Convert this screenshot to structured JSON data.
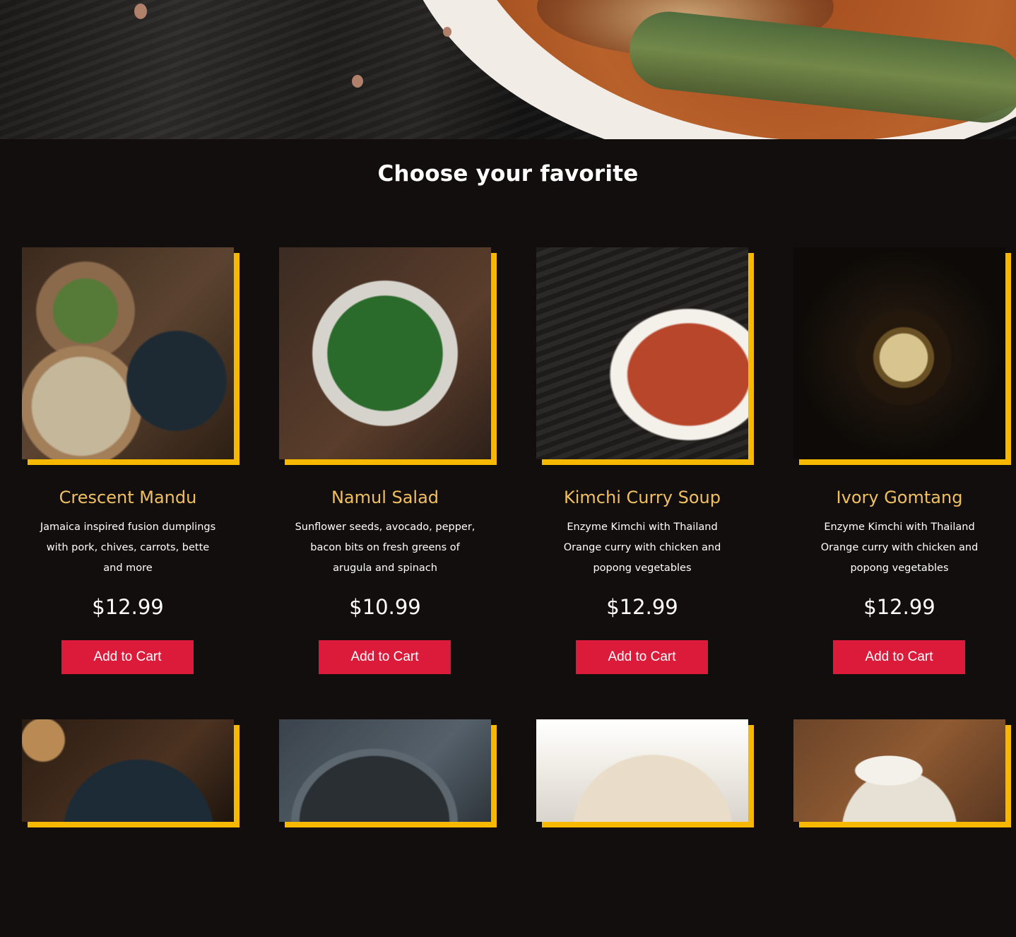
{
  "section": {
    "title": "Choose your favorite"
  },
  "colors": {
    "background": "#130e0e",
    "accent": "#f6b800",
    "name": "#f0c060",
    "button": "#dc1a3a"
  },
  "products": [
    {
      "name": "Crescent Mandu",
      "desc": [
        "Jamaica inspired fusion dumplings",
        "with pork, chives, carrots, bette",
        "and more"
      ],
      "price": "$12.99",
      "button": "Add to Cart"
    },
    {
      "name": "Namul Salad",
      "desc": [
        "Sunflower seeds, avocado, pepper,",
        "bacon bits on fresh greens of",
        "arugula and spinach"
      ],
      "price": "$10.99",
      "button": "Add to Cart"
    },
    {
      "name": "Kimchi Curry Soup",
      "desc": [
        "Enzyme Kimchi with Thailand",
        "Orange curry with chicken and",
        "popong vegetables"
      ],
      "price": "$12.99",
      "button": "Add to Cart"
    },
    {
      "name": "Ivory Gomtang",
      "desc": [
        "Enzyme Kimchi with Thailand",
        "Orange curry with chicken and",
        "popong vegetables"
      ],
      "price": "$12.99",
      "button": "Add to Cart"
    }
  ]
}
